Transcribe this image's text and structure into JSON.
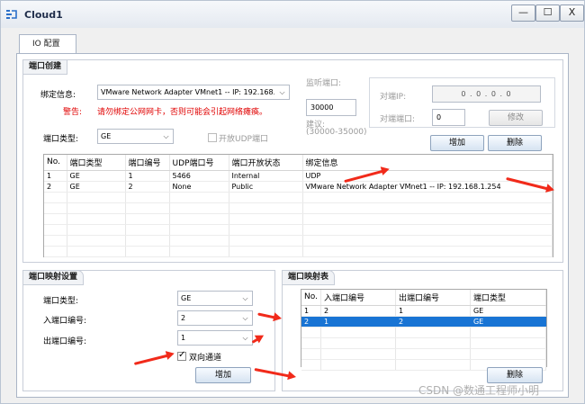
{
  "window": {
    "title": "Cloud1",
    "minimize": "—",
    "maximize": "☐",
    "close": "X"
  },
  "tabs": [
    {
      "label": "IO 配置"
    }
  ],
  "port_create": {
    "title": "端口创建",
    "bind_label": "绑定信息:",
    "bind_value": "VMware Network Adapter VMnet1 -- IP: 192.168.1.254",
    "warn_label": "警告:",
    "warn_text": "请勿绑定公网网卡，否则可能会引起网络瘫痪。",
    "port_type_label": "端口类型:",
    "port_type_value": "GE",
    "open_udp_label": "开放UDP端口",
    "listen_port_label": "监听端口:",
    "listen_port_value": "30000",
    "suggest_label": "建议:",
    "suggest_range": "(30000-35000)",
    "peer_ip_label": "对端IP:",
    "peer_ip_value": "0 . 0 . 0 . 0",
    "peer_port_label": "对端端口:",
    "peer_port_value": "0",
    "modify_button": "修改",
    "add_button": "增加",
    "delete_button": "删除",
    "table": {
      "headers": [
        "No.",
        "端口类型",
        "端口编号",
        "UDP端口号",
        "端口开放状态",
        "绑定信息"
      ],
      "rows": [
        [
          "1",
          "GE",
          "1",
          "5466",
          "Internal",
          "UDP"
        ],
        [
          "2",
          "GE",
          "2",
          "None",
          "Public",
          "VMware Network Adapter VMnet1 -- IP: 192.168.1.254"
        ]
      ],
      "blank_rows": 6
    }
  },
  "port_map_settings": {
    "title": "端口映射设置",
    "port_type_label": "端口类型:",
    "port_type_value": "GE",
    "in_port_label": "入端口编号:",
    "in_port_value": "2",
    "out_port_label": "出端口编号:",
    "out_port_value": "1",
    "bidirectional_label": "双向通道",
    "add_button": "增加"
  },
  "port_map_table": {
    "title": "端口映射表",
    "headers": [
      "No.",
      "入端口编号",
      "出端口编号",
      "端口类型"
    ],
    "rows": [
      [
        "1",
        "2",
        "1",
        "GE"
      ],
      [
        "2",
        "1",
        "2",
        "GE"
      ]
    ],
    "selected_row": 1,
    "blank_rows": 4,
    "delete_button": "删除"
  },
  "watermark": "CSDN @数通工程师小明",
  "colors": {
    "accent_blue": "#1874d4",
    "warning_red": "#e00000",
    "annotation_arrow": "#f12a1a"
  }
}
